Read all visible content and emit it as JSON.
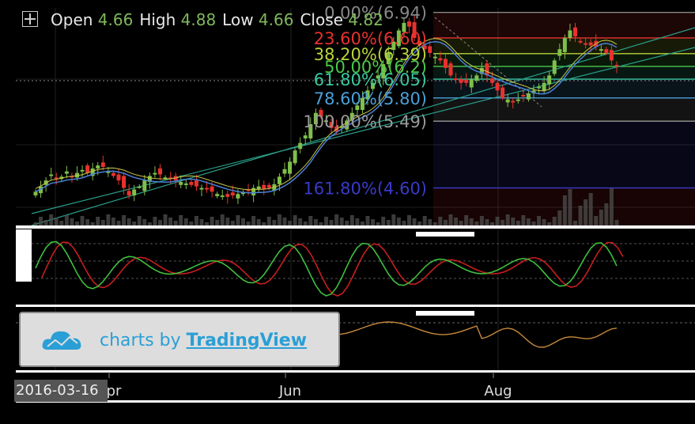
{
  "header": {
    "open_label": "Open",
    "open_value": "4.66",
    "high_label": "High",
    "high_value": "4.88",
    "low_label": "Low",
    "low_value": "4.66",
    "close_label": "Close",
    "close_value": "4.82"
  },
  "watermark": {
    "prefix": "charts by",
    "brand": "TradingView"
  },
  "crosshair_date": "2016-03-16",
  "colors": {
    "up": "#7fbf4a",
    "down": "#e8322e",
    "ma": "#4a7fd6",
    "ma2": "#c8c84a",
    "stoch_k": "#3fbf3f",
    "stoch_d": "#c81e1e",
    "osc": "#c88a3a"
  },
  "chart_data": {
    "type": "candlestick",
    "x_ticks": [
      "pr",
      "Jun",
      "Aug"
    ],
    "y_range": [
      4.1,
      7.0
    ],
    "fibonacci": [
      {
        "label": "0.00%(6.94)",
        "level": 6.94,
        "color": "#888888"
      },
      {
        "label": "23.60%(6.60)",
        "level": 6.6,
        "color": "#e8322e"
      },
      {
        "label": "38.20%(6.39)",
        "level": 6.39,
        "color": "#b8d43a"
      },
      {
        "label": "50.00%(6.2)",
        "level": 6.22,
        "color": "#4ac84a"
      },
      {
        "label": "61.80%(6.05)",
        "level": 6.05,
        "color": "#3ac8a0"
      },
      {
        "label": "78.60%(5.80)",
        "level": 5.8,
        "color": "#4aa0d8"
      },
      {
        "label": "100.00%(5.49)",
        "level": 5.49,
        "color": "#999999"
      },
      {
        "label": "161.80%(4.60)",
        "level": 4.6,
        "color": "#3a3ac8"
      }
    ],
    "close_prices": [
      4.55,
      4.62,
      4.7,
      4.78,
      4.72,
      4.75,
      4.82,
      4.76,
      4.8,
      4.84,
      4.8,
      4.86,
      4.9,
      4.88,
      4.82,
      4.76,
      4.7,
      4.6,
      4.5,
      4.58,
      4.62,
      4.7,
      4.76,
      4.8,
      4.78,
      4.74,
      4.72,
      4.7,
      4.68,
      4.66,
      4.64,
      4.62,
      4.6,
      4.58,
      4.55,
      4.52,
      4.5,
      4.48,
      4.5,
      4.52,
      4.54,
      4.56,
      4.6,
      4.62,
      4.58,
      4.6,
      4.65,
      4.75,
      4.85,
      4.95,
      5.1,
      5.2,
      5.3,
      5.45,
      5.6,
      5.55,
      5.5,
      5.4,
      5.35,
      5.42,
      5.5,
      5.6,
      5.7,
      5.8,
      5.9,
      6.0,
      6.1,
      6.25,
      6.4,
      6.55,
      6.7,
      6.8,
      6.75,
      6.6,
      6.5,
      6.45,
      6.4,
      6.35,
      6.3,
      6.2,
      6.1,
      6.05,
      6.0,
      6.0,
      6.05,
      6.1,
      6.2,
      6.1,
      6.0,
      5.9,
      5.8,
      5.78,
      5.75,
      5.78,
      5.82,
      5.86,
      5.9,
      5.95,
      6.0,
      6.1,
      6.3,
      6.45,
      6.6,
      6.7,
      6.62,
      6.55,
      6.52,
      6.5,
      6.48,
      6.45,
      6.4,
      6.3,
      6.22
    ]
  }
}
